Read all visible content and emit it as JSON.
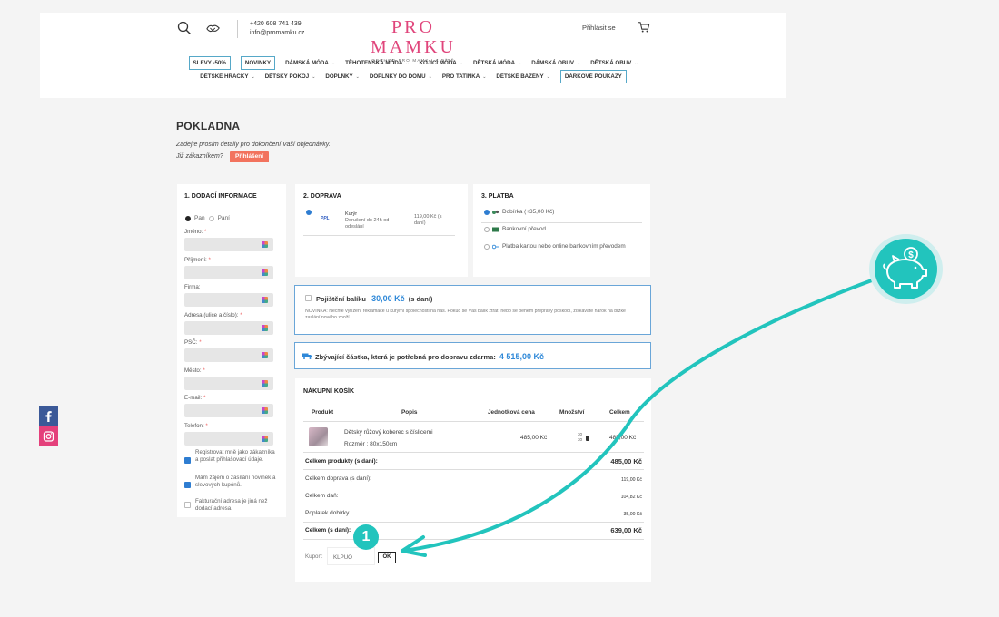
{
  "header": {
    "phone": "+420 608 741 439",
    "email": "info@promamku.cz",
    "logo_title": "PRO MAMKU",
    "logo_subtitle": "OBCHOD PRO MAMKU A DÍTĚ",
    "login_link": "Přihlásit se",
    "nav_row1": [
      {
        "label": "SLEVY -50%",
        "boxed": true,
        "chevron": false
      },
      {
        "label": "NOVINKY",
        "boxed": true,
        "chevron": false
      },
      {
        "label": "DÁMSKÁ MÓDA",
        "boxed": false,
        "chevron": true
      },
      {
        "label": "TĚHOTENSKÁ MÓDA",
        "boxed": false,
        "chevron": true
      },
      {
        "label": "KOJICÍ MÓDA",
        "boxed": false,
        "chevron": true
      },
      {
        "label": "DĚTSKÁ MÓDA",
        "boxed": false,
        "chevron": true
      },
      {
        "label": "DÁMSKÁ OBUV",
        "boxed": false,
        "chevron": true
      },
      {
        "label": "DĚTSKÁ OBUV",
        "boxed": false,
        "chevron": true
      }
    ],
    "nav_row2": [
      {
        "label": "DĚTSKÉ HRAČKY",
        "boxed": false,
        "chevron": true
      },
      {
        "label": "DĚTSKÝ POKOJ",
        "boxed": false,
        "chevron": true
      },
      {
        "label": "DOPLŇKY",
        "boxed": false,
        "chevron": true
      },
      {
        "label": "DOPLŇKY DO DOMU",
        "boxed": false,
        "chevron": true
      },
      {
        "label": "PRO TATÍNKA",
        "boxed": false,
        "chevron": true
      },
      {
        "label": "DĚTSKÉ BAZÉNY",
        "boxed": false,
        "chevron": true
      },
      {
        "label": "DÁRKOVÉ POUKAZY",
        "boxed": true,
        "chevron": false
      }
    ]
  },
  "checkout": {
    "title": "POKLADNA",
    "intro": "Zadejte prosím detaily pro dokončení Vaší objednávky.",
    "existing_customer": "Již zákazníkem?",
    "login_button": "Přihlášení"
  },
  "delivery": {
    "title": "1. DODACÍ INFORMACE",
    "gender_mr": "Pan",
    "gender_mrs": "Paní",
    "fields": [
      {
        "label": "Jméno:",
        "required": "*"
      },
      {
        "label": "Příjmení:",
        "required": "*"
      },
      {
        "label": "Firma:",
        "required": ""
      },
      {
        "label": "Adresa (ulice a číslo):",
        "required": "*"
      },
      {
        "label": "PSČ:",
        "required": "*"
      },
      {
        "label": "Město:",
        "required": "*"
      },
      {
        "label": "E-mail:",
        "required": "*"
      },
      {
        "label": "Telefon:",
        "required": "*"
      }
    ],
    "checkbox_register": "Registrovat mně jako zákazníka a poslat přihlašovací údaje.",
    "checkbox_newsletter": "Mám zájem o zasílání novinek a slevových kupónů.",
    "checkbox_billing": "Fakturační adresa je jiná než dodací adresa."
  },
  "shipping": {
    "title": "2. DOPRAVA",
    "carrier_logo": "PPL",
    "option_name": "Kurýr",
    "option_desc": "Doručení do 24h od odeslání",
    "option_price": "119,00 Kč (s daní)"
  },
  "payment": {
    "title": "3. PLATBA",
    "options": [
      {
        "label": "Dobírka (+35,00 Kč)",
        "selected": true
      },
      {
        "label": "Bankovní převod",
        "selected": false
      },
      {
        "label": "Platba kartou nebo online bankovním převodem",
        "selected": false
      }
    ]
  },
  "insurance": {
    "label": "Pojištění balíku",
    "price": "30,00 Kč",
    "suffix": "(s daní)",
    "description": "NOVINKA: Nechte vyřízení reklamace u kurýrní společnosti na nás. Pokud se Váš balík ztratí nebo se během přepravy poškodí, získáváte nárok na brzké zaslání nového zboží."
  },
  "free_delivery": {
    "text": "Zbývající částka, která je potřebná pro dopravu zdarma:",
    "amount": "4 515,00 Kč"
  },
  "cart": {
    "title": "NÁKUPNÍ KOŠÍK",
    "columns": [
      "Produkt",
      "Popis",
      "Jednotková cena",
      "Množství",
      "Celkem"
    ],
    "item": {
      "name": "Dětský růžový koberec s číslicemi",
      "attribute": "Rozměr : 80x150cm",
      "unit_price": "485,00 Kč",
      "qty_up": "30",
      "qty_down": "30",
      "total": "485,00 Kč"
    },
    "summary": [
      {
        "label": "Celkem produkty (s daní):",
        "value": "485,00 Kč",
        "bold": true
      },
      {
        "label": "Celkem doprava (s daní):",
        "value": "119,00 Kč",
        "bold": false
      },
      {
        "label": "Celkem daň:",
        "value": "104,82 Kč",
        "bold": false
      },
      {
        "label": "Poplatek dobírky",
        "value": "35,00 Kč",
        "bold": false
      }
    ],
    "grand_total_label": "Celkem (s daní):",
    "grand_total_value": "639,00 Kč",
    "coupon_label": "Kupon:",
    "coupon_value": "KLPUO",
    "coupon_button": "OK"
  },
  "annotation": {
    "step_number": "1",
    "accent_color": "#22c4bd"
  },
  "colors": {
    "brand_pink": "#e0457b",
    "link_blue": "#2e88d8",
    "login_button": "#f2735e",
    "facebook": "#3b5998",
    "instagram": "#e4407b"
  }
}
